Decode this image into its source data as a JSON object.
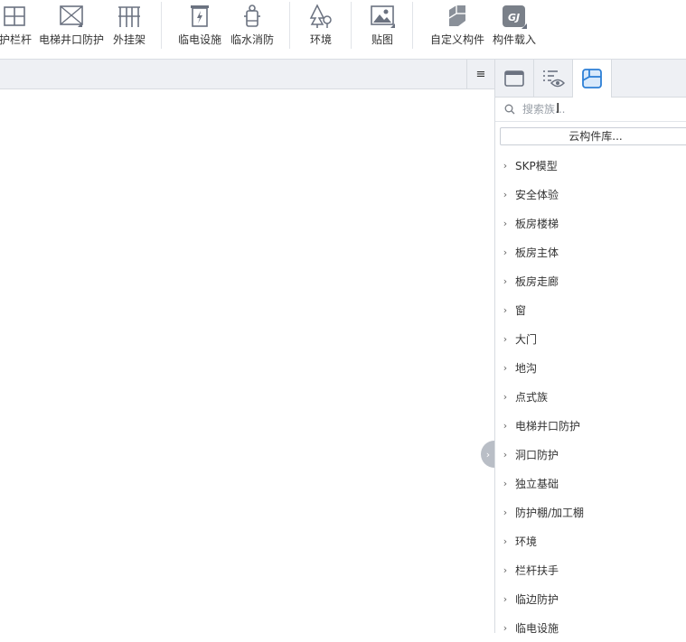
{
  "ribbon": {
    "items": [
      {
        "label": "护栏杆",
        "icon": "railing-icon"
      },
      {
        "label": "电梯井口防护",
        "icon": "elevator-shaft-guard-icon"
      },
      {
        "label": "外挂架",
        "icon": "scaffold-icon"
      },
      {
        "label": "临电设施",
        "icon": "power-facility-icon"
      },
      {
        "label": "临水消防",
        "icon": "fire-hydrant-icon"
      },
      {
        "label": "环境",
        "icon": "tree-icon"
      },
      {
        "label": "贴图",
        "icon": "image-texture-icon"
      },
      {
        "label": "自定义构件",
        "icon": "custom-component-icon"
      },
      {
        "label": "构件载入",
        "icon": "gj-load-icon"
      }
    ]
  },
  "main": {
    "menu_glyph": "≡"
  },
  "panel": {
    "tabs": [
      "window-tab-icon",
      "visibility-list-icon",
      "component-library-icon"
    ],
    "search": {
      "placeholder": "搜索族..."
    },
    "cloud_button": "云构件库...",
    "tree": [
      "SKP模型",
      "安全体验",
      "板房楼梯",
      "板房主体",
      "板房走廊",
      "窗",
      "大门",
      "地沟",
      "点式族",
      "电梯井口防护",
      "洞口防护",
      "独立基础",
      "防护棚/加工棚",
      "环境",
      "栏杆扶手",
      "临边防护",
      "临电设施"
    ]
  },
  "colors": {
    "accent": "#2d7fd6",
    "icon_gray": "#6b7280"
  }
}
